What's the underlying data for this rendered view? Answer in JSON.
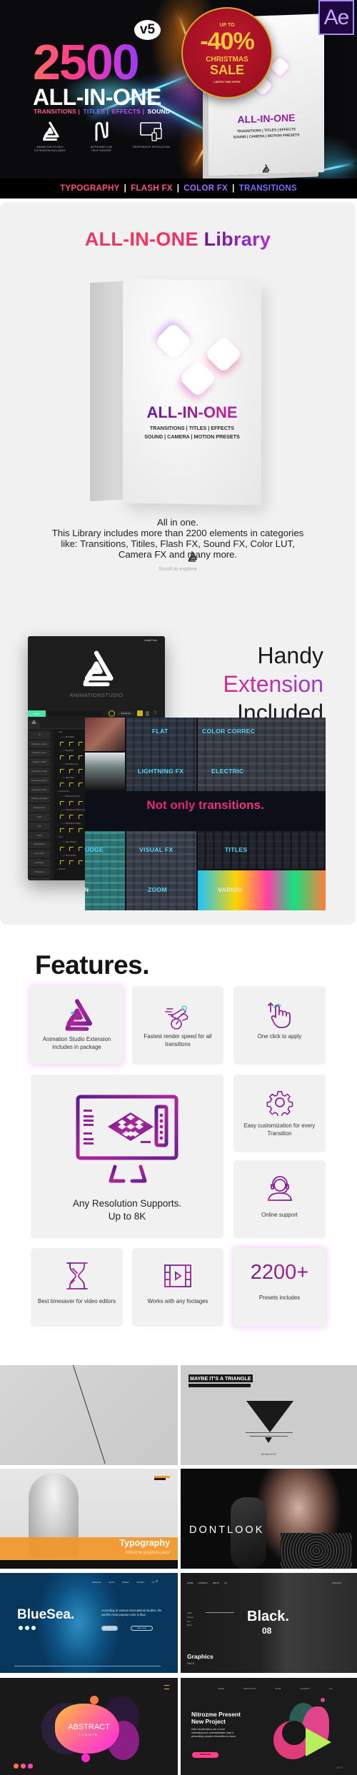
{
  "hero": {
    "version_badge": "v5",
    "count": "2500",
    "title": "ALL-IN-ONE",
    "subtitle_parts": [
      {
        "text": "TRANSITIONS |",
        "color": "#ff5b8a"
      },
      {
        "text": "TITLES |",
        "color": "#8a6cff"
      },
      {
        "text": "EFFECTS |",
        "color": "#c34ee6"
      },
      {
        "text": "SOUND",
        "color": "#ffffff"
      }
    ],
    "features": [
      {
        "icon": "animation-studio-logo-icon",
        "caption_line1": "ANIMATION STUDIO",
        "caption_line2": "EXTENSION INCLUDES"
      },
      {
        "icon": "nitrozme-logo-icon",
        "caption_line1": "NITROZME.COM",
        "caption_line2": "HELP CENTER"
      },
      {
        "icon": "responsive-devices-icon",
        "caption_line1": "RESPONSIVE RESOLUTION",
        "caption_line2": ""
      }
    ],
    "sale": {
      "line1": "UP TO",
      "discount": "-40%",
      "line3": "CHRISTMAS",
      "line4": "SALE",
      "footnote": "LIMITED TIME OFFER"
    },
    "box": {
      "title": "ALL-IN-ONE",
      "line1": "TRANSITIONS | TITLES | EFFECTS",
      "line2": "SOUND | CAMERA | MOTION PRESETS"
    },
    "app_badge": "Ae",
    "bottom_bar": [
      {
        "text": "TYPOGRAPHY",
        "color": "#ff4d7a"
      },
      {
        "text": "|",
        "color": "#ffffff"
      },
      {
        "text": "FLASH FX",
        "color": "#ff4d9a"
      },
      {
        "text": "|",
        "color": "#ffffff"
      },
      {
        "text": "COLOR FX",
        "color": "#a366ff"
      },
      {
        "text": "|",
        "color": "#ffffff"
      },
      {
        "text": "TRANSITIONS",
        "color": "#7a6bff"
      }
    ]
  },
  "library": {
    "title_part1": "ALL-IN-ONE",
    "title_part2": "Library",
    "box": {
      "title": "ALL-IN-ONE",
      "line1": "TRANSITIONS | TITLES | EFFECTS",
      "line2": "SOUND | CAMERA | MOTION PRESETS"
    },
    "description_line1": "All in one.",
    "description_rest": "This Library includes more than 2200 elements in categories like: Transitions, Titiles, Flash FX, Sound FX, Color LUT, Camera FX and many more.",
    "scroll_hint": "Scroll to explore"
  },
  "extension": {
    "install_label": "Install Pack",
    "brand": "ANIMATIONSTUDIO",
    "apply_label": "APPLY",
    "dashboard_label": "Dashboard",
    "categories": [
      "All",
      "Designed_Cartoon",
      "Designed_Glass",
      "Designed_Glitch",
      "Designed_Grunge",
      "Designed_Modern",
      "Designed_Smoke",
      "Designed_Smudge",
      "Displacement",
      "Fade",
      "Flat",
      "Glitch",
      "Kaleidoscope",
      "Light Leaks",
      "Panoramic",
      "Perspective",
      "Shapes"
    ],
    "tree": [
      {
        "type": "group",
        "label": "Flat"
      },
      {
        "type": "sub",
        "label": "Flat Warp",
        "icons": 6
      },
      {
        "type": "sub",
        "label": "Flat Roll",
        "icons": 4
      },
      {
        "type": "sub",
        "label": "Flat Roll Long",
        "icons": 4
      },
      {
        "type": "sub",
        "label": "Flat Short",
        "icons": 4
      },
      {
        "type": "group",
        "label": "Panoramic"
      },
      {
        "type": "sub",
        "label": "Panoramic Roll",
        "icons": 4
      },
      {
        "type": "sub",
        "label": "Panoramic Roll Long",
        "icons": 4
      },
      {
        "type": "sub",
        "label": "Panoramic Warp",
        "icons": 4
      },
      {
        "type": "group",
        "label": "Spin"
      },
      {
        "type": "sub",
        "label": "Spin Simple",
        "icons": 10
      },
      {
        "type": "sub",
        "label": "Spin Vortex",
        "icons": 10
      },
      {
        "type": "group",
        "label": "Stretch"
      }
    ],
    "headline_line1": "Handy",
    "headline_line2": "Extension",
    "headline_line3": "Included",
    "mosaic_tagline": "Not only transitions.",
    "mosaic_labels": [
      "FLAT",
      "COLOR CORREC",
      "LIGHTNING FX",
      "ELECTRIC",
      "UDGE",
      "VISUAL FX",
      "TITLES",
      "CARTOON",
      "ZOOM",
      "VARIOU"
    ]
  },
  "features": {
    "heading": "Features.",
    "cards": [
      {
        "icon": "animation-studio-logo-icon",
        "text": "Animation Studio Extension includes in package"
      },
      {
        "icon": "render-speed-icon",
        "text": "Fastest render speed for all transitions"
      },
      {
        "icon": "click-hand-icon",
        "text": "One click to apply"
      },
      {
        "icon": "monitor-icon",
        "text_line1": "Any Resolution Supports.",
        "text_line2": "Up to 8K"
      },
      {
        "icon": "gear-icon",
        "text": "Easy customization for every Transition"
      },
      {
        "icon": "support-agent-icon",
        "text": "Online support"
      },
      {
        "icon": "hourglass-icon",
        "text": "Best timesaver for video editors"
      },
      {
        "icon": "film-play-icon",
        "text": "Works with any footages"
      },
      {
        "number": "2200+",
        "text": "Presets includes"
      }
    ]
  },
  "showcase": {
    "triangle": {
      "title": "MAYBE IT'S A TRIANGLE",
      "caption": "MINIMALISTIC"
    },
    "typography": {
      "title": "Typography",
      "subtitle": "Nitrozme graphics pack"
    },
    "dontlook": {
      "title": "DONTLOOK"
    },
    "bluesea": {
      "title": "BlueSea.",
      "nav": [
        "Welcome",
        "Home",
        "Project",
        "Contact Us"
      ],
      "text": "According to various international studies, the world's most popular color is blue.",
      "btn1": "Discover more",
      "btn2": "Learn more"
    },
    "black": {
      "nav": [
        "HOME",
        "COMPANY",
        "ABOUT US"
      ],
      "contact": "CONTACT",
      "menu": [
        "Gallery",
        "Products",
        "Price",
        "Blocks"
      ],
      "title": "Black.",
      "number": "08",
      "footer_title": "Graphics",
      "footer_sub": "PACK"
    },
    "abstract": {
      "title": "ABSTRACT",
      "subtitle": "LIQUID"
    },
    "nitro": {
      "nav": [
        "HOME",
        "PORTFOLIO",
        "TEAM",
        "CONTACT US"
      ],
      "title_line1": "Nitrozme Present",
      "title_line2": "New Project",
      "text": "Data visualizations are a more interesting and understandable way to presenting complex information to users.",
      "button": "DOWNLOAD",
      "help": "HELP"
    }
  }
}
